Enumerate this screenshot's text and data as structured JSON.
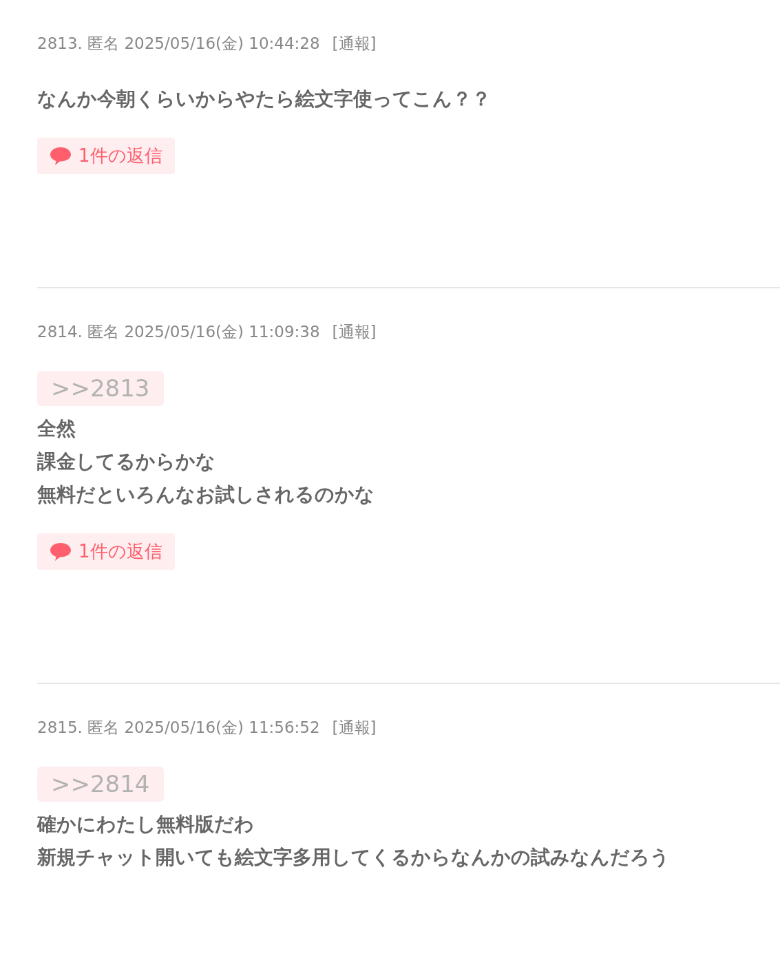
{
  "posts": [
    {
      "meta": "2813. 匿名 2025/05/16(金) 10:44:28",
      "report": "[通報]",
      "lines": [
        "なんか今朝くらいからやたら絵文字使ってこん？？"
      ],
      "replies": "1件の返信"
    },
    {
      "meta": "2814. 匿名 2025/05/16(金) 11:09:38",
      "report": "[通報]",
      "anchor": ">>2813",
      "lines": [
        "全然",
        "課金してるからかな",
        "無料だといろんなお試しされるのかな"
      ],
      "replies": "1件の返信"
    },
    {
      "meta": "2815. 匿名 2025/05/16(金) 11:56:52",
      "report": "[通報]",
      "anchor": ">>2814",
      "lines": [
        "確かにわたし無料版だわ",
        "新規チャット開いても絵文字多用してくるからなんかの試みなんだろう"
      ]
    }
  ]
}
